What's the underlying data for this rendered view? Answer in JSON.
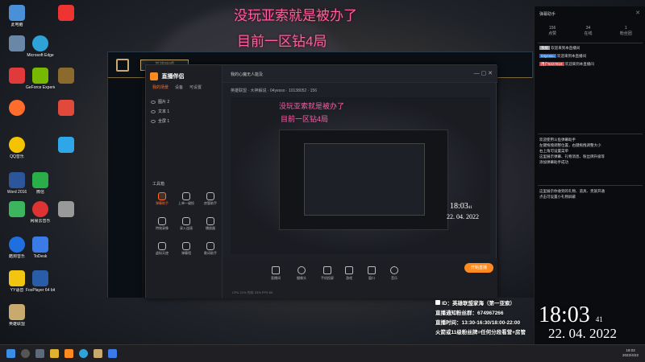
{
  "overlay": {
    "line1": "没玩亚索就是被办了",
    "line2": "目前一区钻4局"
  },
  "desktop_icons": [
    {
      "label": "此电脑",
      "color": "#4a90d9"
    },
    {
      "label": "FoxPlayer 64 bit",
      "color": "#2a5da8"
    },
    {
      "label": "微信",
      "color": "#2aae4a"
    },
    {
      "label": "Microsoft Edge",
      "color": "#2fa3d8"
    },
    {
      "label": "GeForce Experience",
      "color": "#76b900"
    },
    {
      "label": "QQ音乐",
      "color": "#f5c400"
    },
    {
      "label": "网易云音乐",
      "color": "#d33"
    },
    {
      "label": "Word 2016",
      "color": "#2b579a"
    },
    {
      "label": "英雄联盟",
      "color": "#c8aa6e"
    },
    {
      "label": "酷狗音乐",
      "color": "#1f6fe0"
    },
    {
      "label": "YY语音",
      "color": "#f2c511"
    },
    {
      "label": "ToDesk",
      "color": "#3a7be8"
    }
  ],
  "lol_window": {
    "title": "英雄联盟"
  },
  "douyu_helper": {
    "app_name": "直播伴侣",
    "tabs": [
      "我的场景",
      "设备",
      "可设置"
    ],
    "scenes": [
      "图片 2",
      "文本 1",
      "全屏 1"
    ],
    "tool_title": "工具箱",
    "tools": [
      "弹幕助手",
      "上单一键投",
      "房管助手",
      "特效录像",
      "录入连接",
      "播放器",
      "虚拟天使",
      "弹幕墙",
      "歌词助手",
      "观众连麦",
      "连麦PK",
      "更多"
    ],
    "live_title": "我的心魔无人能及",
    "live_meta": "英雄联盟 · 大神解说 · 04yesso · 10138052 · 156",
    "bottom_tools": [
      "直播间",
      "摄像头",
      "手机投屏",
      "游戏",
      "窗口",
      "音乐"
    ],
    "start_button": "开始直播",
    "status": "CPU 21%  内存 23%  FPS 60"
  },
  "side_panel": {
    "title": "弹幕助手",
    "stats": [
      {
        "value": "156",
        "label": "点赞"
      },
      {
        "value": "34",
        "label": "在线"
      },
      {
        "value": "1",
        "label": "粉丝团"
      }
    ],
    "messages": [
      {
        "tag": "系统",
        "text": "欢迎来到本直播间"
      },
      {
        "tag": "04yesso",
        "text": "欢迎来到本直播间"
      },
      {
        "tag": "用户5227818",
        "text": "欢迎来到本直播间"
      }
    ],
    "notice1": "欢迎使用斗鱼弹幕助手\n左键拖拽调整位置，右键拖拽调整大小\n右上角可设置菜单\n这里展示弹幕、礼物消息、粉丝牌升级等\n添加弹幕助手成功",
    "notice2": "这里展示你收到的礼物、道具、贵族开通\n点击可设置小礼物屏蔽"
  },
  "info": {
    "line1": "ID：英雄联盟家海（第一亚索）",
    "line2": "直播通知粉丝群：674967266",
    "line3": "直播时间：13:30-16:30/18:00-22:00",
    "line4": "火箭或11级粉丝牌=任何分段看营+房管"
  },
  "clock": {
    "time": "18:03",
    "seconds": "41",
    "date": "22. 04. 2022",
    "mini_time": "18:03",
    "mini_seconds": "41",
    "mini_date": "22. 04. 2022"
  },
  "taskbar": {
    "time": "18:03",
    "date": "2022/4/22"
  }
}
